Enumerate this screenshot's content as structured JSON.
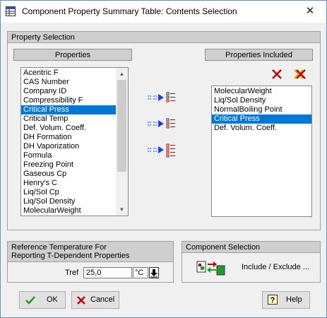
{
  "window": {
    "title": "Component Property Summary Table:  Contents Selection",
    "close_glyph": "✕"
  },
  "property_selection": {
    "group_label": "Property Selection",
    "properties_header": "Properties",
    "included_header": "Properties Included",
    "properties": [
      "Acentric F",
      "CAS Number",
      "Company ID",
      "Compressibility F",
      "Critical Press",
      "Critical Temp",
      "Def. Volum. Coeff.",
      "DH Formation",
      "DH Vaporization",
      "Formula",
      "Freezing Point",
      "Gaseous Cp",
      "Henry's C",
      "Liq/Sol Cp",
      "Liq/Sol Density",
      "MolecularWeight"
    ],
    "properties_selected": "Critical Press",
    "included": [
      "MolecularWeight",
      "Liq/Sol Density",
      "NormalBoiling Point",
      "Critical Press",
      "Def. Volum. Coeff."
    ],
    "included_selected": "Critical Press"
  },
  "reference_temperature": {
    "label": "Reference Temperature For\nReporting T-Dependent Properties",
    "tref_label": "Tref",
    "tref_value": "25,0",
    "unit": "°C"
  },
  "component_selection": {
    "label": "Component Selection",
    "button_label": "Include / Exclude ..."
  },
  "footer": {
    "ok": "OK",
    "cancel": "Cancel",
    "help": "Help"
  },
  "colors": {
    "selection": "#0078d7",
    "arrow_blue": "#1a3cff",
    "delete_red": "#c00000",
    "include_green": "#1f9b2e"
  }
}
